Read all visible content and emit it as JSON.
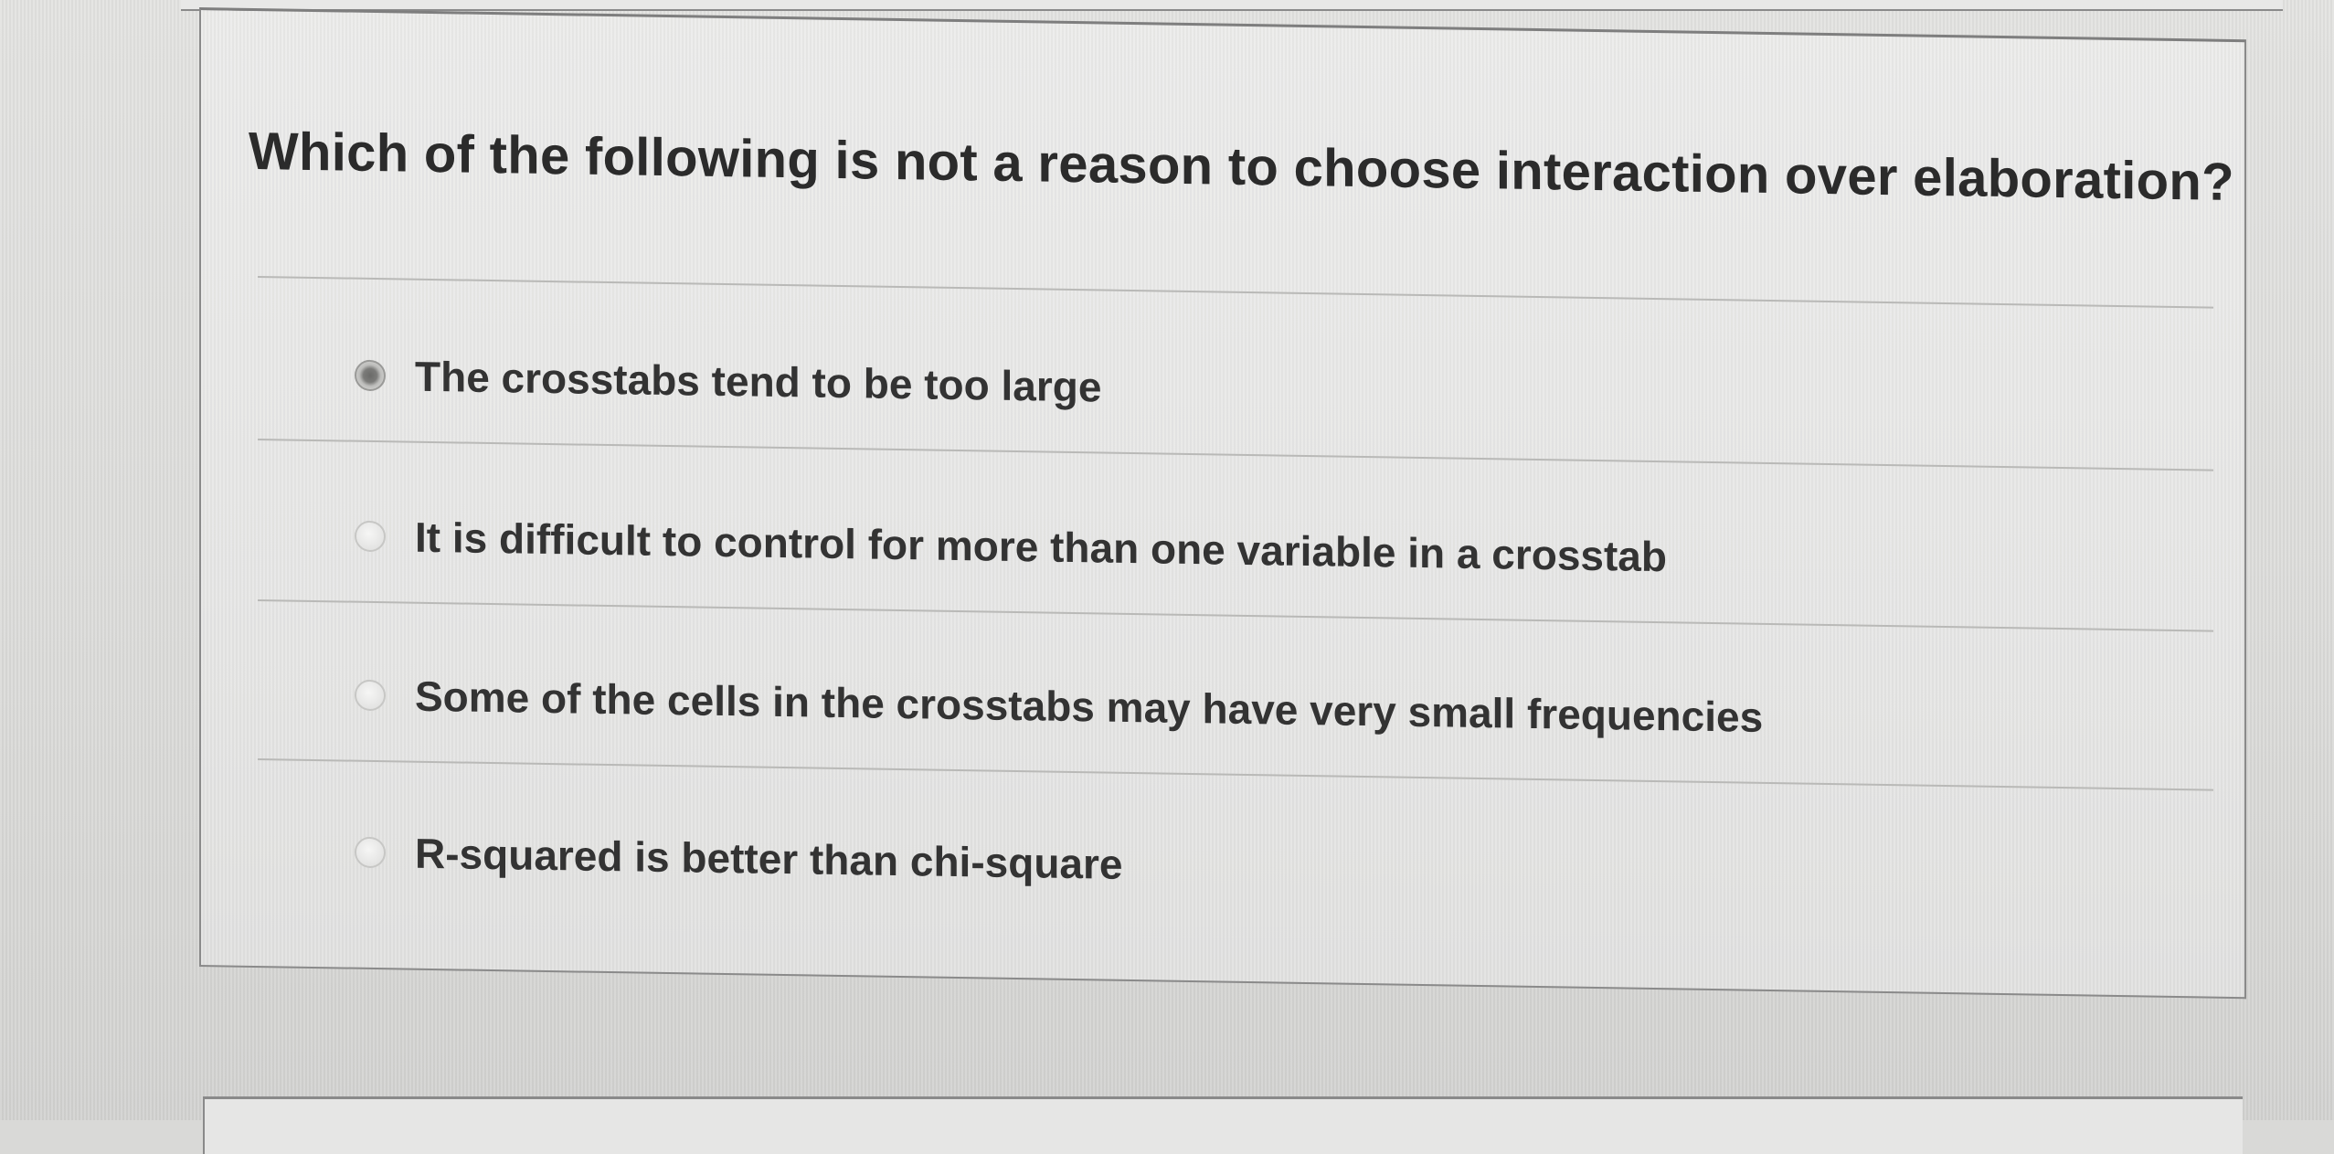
{
  "question": {
    "text": "Which of the following is not a reason to choose interaction over elaboration?"
  },
  "options": [
    {
      "label": "The crosstabs tend to be too large",
      "selected": true
    },
    {
      "label": "It is difficult to control for more than one variable in a crosstab",
      "selected": false
    },
    {
      "label": "Some of the cells in the crosstabs may have very small frequencies",
      "selected": false
    },
    {
      "label": "R-squared is better than chi-square",
      "selected": false
    }
  ]
}
